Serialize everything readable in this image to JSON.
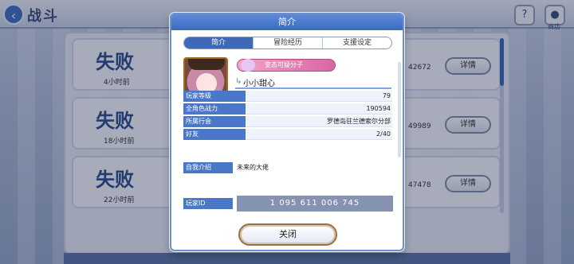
{
  "battle_log": {
    "title": "战斗",
    "rows": [
      {
        "result": "失败",
        "time": "4小时前",
        "number": "42672",
        "detail": "详情"
      },
      {
        "result": "失败",
        "time": "18小时前",
        "number": "49989",
        "detail": "详情"
      },
      {
        "result": "失败",
        "time": "22小时前",
        "number": "47478",
        "detail": "详情"
      }
    ],
    "top_icon_label": "商店"
  },
  "modal": {
    "title": "简介",
    "tabs": [
      {
        "label": "简介",
        "active": true
      },
      {
        "label": "冒险经历",
        "active": false
      },
      {
        "label": "支援设定",
        "active": false
      }
    ],
    "player": {
      "title_badge": "变态可疑分子",
      "name": "小小甜心"
    },
    "stats": [
      {
        "label": "玩家等级",
        "value": "79"
      },
      {
        "label": "全角色战力",
        "value": "190594"
      },
      {
        "label": "所属行会",
        "value": "罗德岛驻兰德索尔分部"
      },
      {
        "label": "好友",
        "value": "2/40"
      }
    ],
    "intro": {
      "label": "自我介绍",
      "text": "未来的大佬"
    },
    "player_id": {
      "label": "玩家ID",
      "value": "1 095 611 006 745"
    },
    "close_label": "关闭"
  },
  "colors": {
    "header_blue": "#3d6abf",
    "label_blue": "#4a78c6",
    "id_box": "#8592b1",
    "result_blue": "#2a4d8c"
  }
}
